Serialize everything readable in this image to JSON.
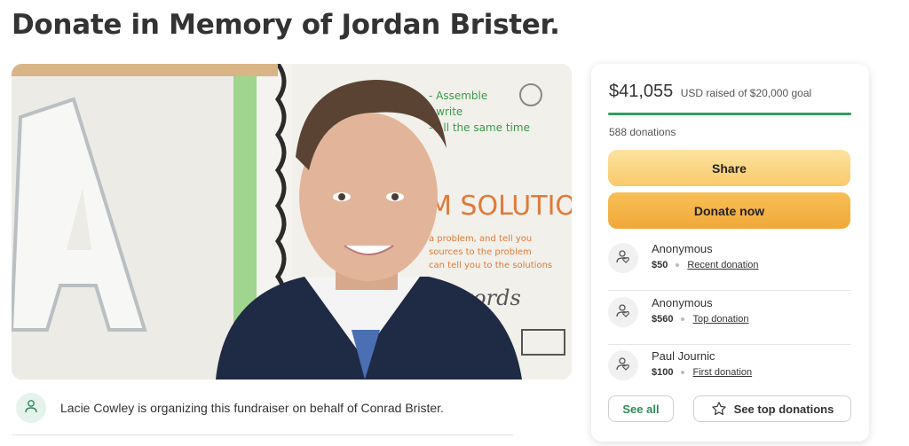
{
  "page": {
    "title": "Donate in Memory of Jordan Brister."
  },
  "fundraiser": {
    "raised_amount": "$41,055",
    "raised_text": "USD raised of $20,000 goal",
    "progress_fraction": 1.0,
    "donation_count": "588 donations",
    "share_label": "Share",
    "donate_label": "Donate now"
  },
  "donations": [
    {
      "name": "Anonymous",
      "amount": "$50",
      "tag": "Recent donation"
    },
    {
      "name": "Anonymous",
      "amount": "$560",
      "tag": "Top donation"
    },
    {
      "name": "Paul Journic",
      "amount": "$100",
      "tag": "First donation"
    }
  ],
  "actions": {
    "see_all": "See all",
    "see_top": "See top donations"
  },
  "organizer": {
    "text": "Lacie Cowley is organizing this fundraiser on behalf of Conrad Brister."
  },
  "colors": {
    "accent_green": "#2f9e5c",
    "donate_orange": "#f1a83a",
    "share_yellow": "#f8c96a"
  }
}
